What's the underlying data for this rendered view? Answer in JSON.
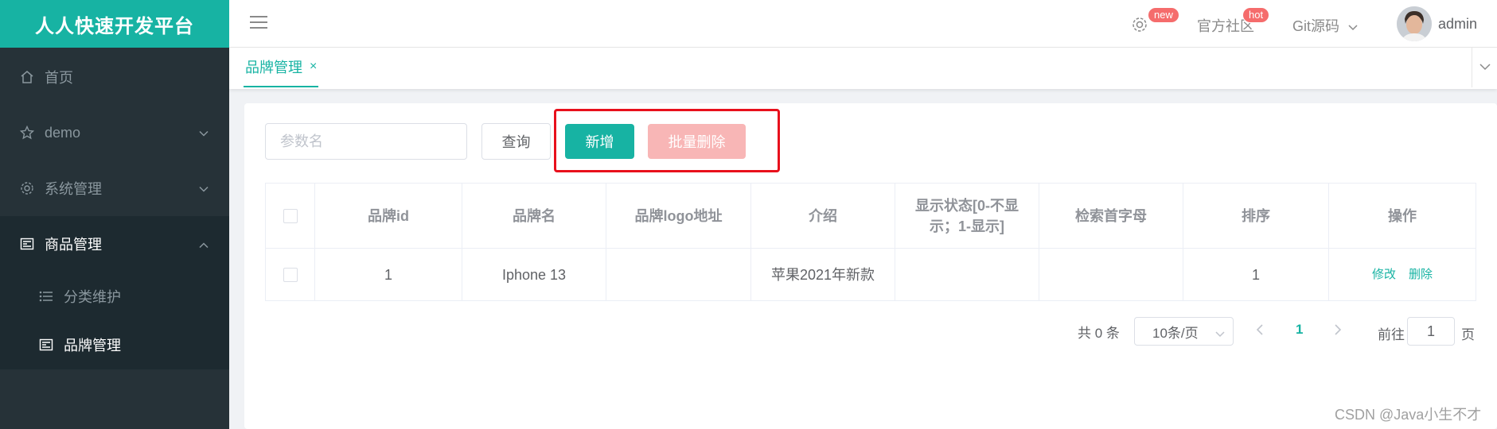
{
  "brand": {
    "title": "人人快速开发平台",
    "color": "#17b3a3"
  },
  "sidebar": {
    "items": [
      {
        "label": "首页",
        "icon": "home-icon"
      },
      {
        "label": "demo",
        "icon": "star-icon",
        "expandable": true
      },
      {
        "label": "系统管理",
        "icon": "gear-icon",
        "expandable": true
      },
      {
        "label": "商品管理",
        "icon": "card-icon",
        "expandable": true,
        "expanded": true
      }
    ],
    "submenu": [
      {
        "label": "分类维护",
        "icon": "list-icon"
      },
      {
        "label": "品牌管理",
        "icon": "card-icon",
        "current": true
      }
    ]
  },
  "header": {
    "new_badge": "new",
    "community": "官方社区",
    "hot_badge": "hot",
    "git": "Git源码",
    "username": "admin"
  },
  "tabs": [
    {
      "label": "品牌管理",
      "close": "×"
    }
  ],
  "toolbar": {
    "search_placeholder": "参数名",
    "query_label": "查询",
    "add_label": "新增",
    "batch_delete_label": "批量删除"
  },
  "table": {
    "columns": [
      "品牌id",
      "品牌名",
      "品牌logo地址",
      "介绍",
      "显示状态[0-不显示；1-显示]",
      "检索首字母",
      "排序",
      "操作"
    ],
    "rows": [
      {
        "id": "1",
        "name": "Iphone 13",
        "logo": "",
        "intro": "苹果2021年新款",
        "status": "",
        "first_letter": "",
        "sort": "1",
        "edit": "修改",
        "delete": "删除"
      }
    ]
  },
  "pagination": {
    "total": "共 0 条",
    "page_size": "10条/页",
    "current_page": "1",
    "goto_label": "前往",
    "goto_value": "1",
    "page_suffix": "页"
  },
  "watermark": "CSDN @Java小生不才"
}
